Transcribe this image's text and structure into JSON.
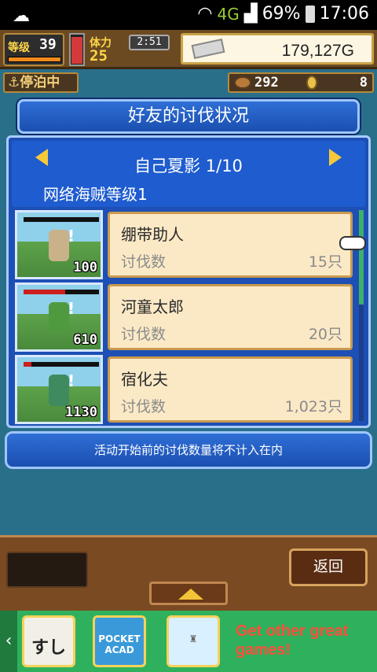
{
  "status_bar": {
    "network": "4G",
    "battery": "69%",
    "time": "17:06"
  },
  "hud": {
    "level_label": "等级",
    "level_value": "39",
    "stamina_label": "体力",
    "stamina_value": "25",
    "timer": "2:51",
    "gold": "179,127G"
  },
  "secondary": {
    "dock_status": "停泊中",
    "resource_1": "292",
    "resource_2": "8"
  },
  "title": "好友的讨伐状况",
  "friend": {
    "name_page": "自己夏影 1/10",
    "pirate_level": "网络海贼等级1"
  },
  "targets": [
    {
      "name": "绷带助人",
      "label": "讨伐数",
      "count": "15只",
      "kills": "100",
      "hp_color": "#cc1f1f",
      "hp_fraction": 0.0,
      "sprite_color": "#c9b28a"
    },
    {
      "name": "河童太郎",
      "label": "讨伐数",
      "count": "20只",
      "kills": "610",
      "hp_color": "#cc1f1f",
      "hp_fraction": 0.55,
      "sprite_color": "#4f9a3f"
    },
    {
      "name": "宿化夫",
      "label": "讨伐数",
      "count": "1,023只",
      "kills": "1130",
      "hp_color": "#cc1f1f",
      "hp_fraction": 0.1,
      "sprite_color": "#3f8a5f"
    }
  ],
  "notice": "活动开始前的讨伐数量将不计入在内",
  "bottom": {
    "back_label": "返回"
  },
  "ad": {
    "app_1": "すし",
    "app_2": "POCKET ACAD",
    "text": "Get other great games!"
  },
  "colors": {
    "panel_blue": "#1d4fb4",
    "card_bg": "#fbe9c6",
    "gold_arrow": "#f6c93a"
  }
}
